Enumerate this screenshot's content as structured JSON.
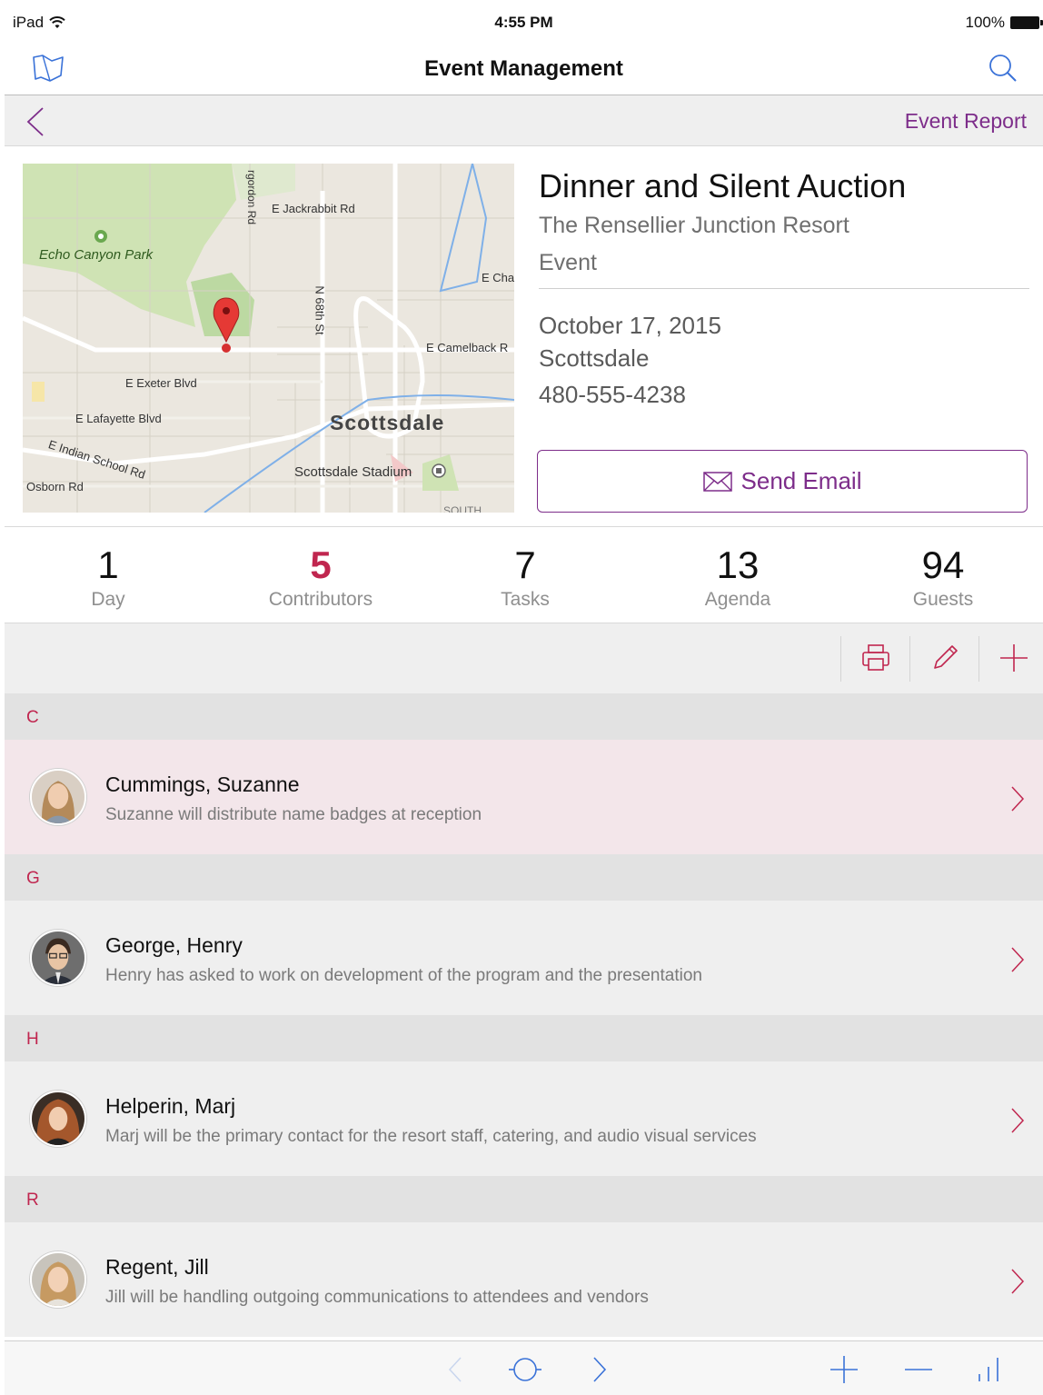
{
  "status_bar": {
    "carrier": "iPad",
    "time": "4:55 PM",
    "battery": "100%"
  },
  "nav": {
    "title": "Event Management",
    "left_icon": "folder-icon",
    "right_icon": "search-icon"
  },
  "sub_nav": {
    "back_icon": "chevron-left-icon",
    "report_label": "Event Report"
  },
  "map": {
    "labels": {
      "park": "Echo Canyon Park",
      "gordon": "rgordon Rd",
      "jackrabbit": "E Jackrabbit Rd",
      "cha": "E Cha",
      "st68": "N 68th St",
      "camelback": "E Camelback R",
      "exeter": "E Exeter Blvd",
      "lafayette": "E Lafayette Blvd",
      "city": "Scottsdale",
      "indian": "E Indian School Rd",
      "stadium": "Scottsdale Stadium",
      "osborn": "Osborn Rd",
      "south": "SOUTH"
    }
  },
  "event": {
    "title": "Dinner and Silent Auction",
    "venue": "The Rensellier Junction Resort",
    "type": "Event",
    "date": "October 17, 2015",
    "city": "Scottsdale",
    "phone": "480-555-4238",
    "email_button": "Send Email"
  },
  "stats": [
    {
      "value": "1",
      "label": "Day"
    },
    {
      "value": "5",
      "label": "Contributors"
    },
    {
      "value": "7",
      "label": "Tasks"
    },
    {
      "value": "13",
      "label": "Agenda"
    },
    {
      "value": "94",
      "label": "Guests"
    }
  ],
  "toolbar": {
    "icons": [
      "print-icon",
      "edit-icon",
      "add-icon"
    ]
  },
  "sections": [
    {
      "letter": "C",
      "items": [
        {
          "name": "Cummings, Suzanne",
          "description": "Suzanne will distribute name badges at reception"
        }
      ]
    },
    {
      "letter": "G",
      "items": [
        {
          "name": "George, Henry",
          "description": "Henry has asked to work on development of the program and the presentation"
        }
      ]
    },
    {
      "letter": "H",
      "items": [
        {
          "name": "Helperin, Marj",
          "description": "Marj will be the primary contact for the resort staff, catering, and audio visual services"
        }
      ]
    },
    {
      "letter": "R",
      "items": [
        {
          "name": "Regent, Jill",
          "description": "Jill will be handling outgoing communications to attendees and vendors"
        }
      ]
    }
  ],
  "colors": {
    "accent": "#7d2d8a",
    "highlight": "#c0264f",
    "ios_blue": "#3a72d8"
  }
}
